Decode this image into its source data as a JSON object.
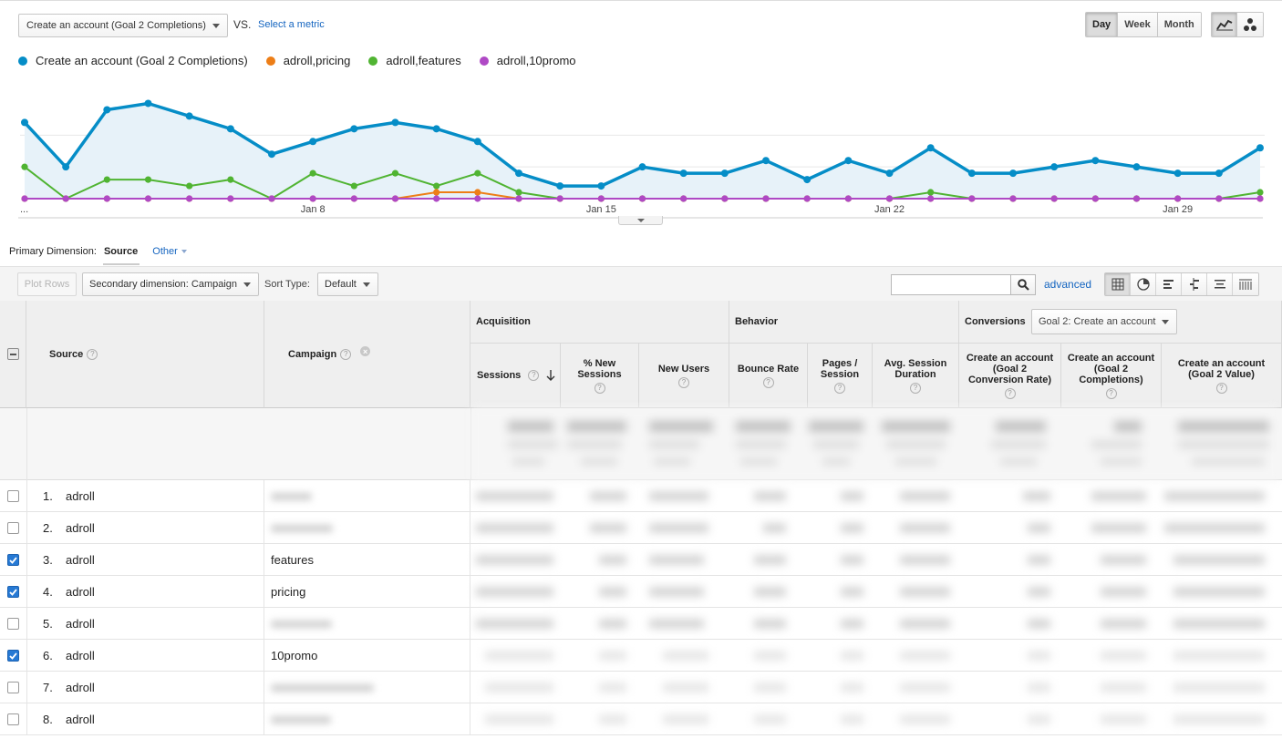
{
  "header": {
    "metric_select": "Create an account (Goal 2 Completions)",
    "vs_label": "VS.",
    "select_metric_link": "Select a metric",
    "periods": [
      "Day",
      "Week",
      "Month"
    ],
    "active_period": "Day"
  },
  "legend": [
    {
      "label": "Create an account (Goal 2 Completions)",
      "color": "#058dc7"
    },
    {
      "label": "adroll,pricing",
      "color": "#ed7e17"
    },
    {
      "label": "adroll,features",
      "color": "#50b432"
    },
    {
      "label": "adroll,10promo",
      "color": "#af49c5"
    }
  ],
  "chart_data": {
    "type": "line",
    "x_tick_labels": [
      "...",
      "Jan 8",
      "Jan 15",
      "Jan 22",
      "Jan 29"
    ],
    "series": [
      {
        "name": "Create an account (Goal 2 Completions)",
        "color": "#058dc7",
        "area": true,
        "values": [
          12,
          5,
          14,
          15,
          13,
          11,
          7,
          9,
          11,
          12,
          11,
          9,
          4,
          2,
          2,
          5,
          4,
          4,
          6,
          3,
          6,
          4,
          8,
          4,
          4,
          5,
          6,
          5,
          4,
          4,
          8
        ]
      },
      {
        "name": "adroll,pricing",
        "color": "#ed7e17",
        "area": false,
        "values": [
          0,
          0,
          0,
          0,
          0,
          0,
          0,
          0,
          0,
          0,
          1,
          1,
          0,
          0,
          0,
          0,
          0,
          0,
          0,
          0,
          0,
          0,
          0,
          0,
          0,
          0,
          0,
          0,
          0,
          0,
          0
        ]
      },
      {
        "name": "adroll,features",
        "color": "#50b432",
        "area": false,
        "values": [
          5,
          0,
          3,
          3,
          2,
          3,
          0,
          4,
          2,
          4,
          2,
          4,
          1,
          0,
          0,
          0,
          0,
          0,
          0,
          0,
          0,
          0,
          1,
          0,
          0,
          0,
          0,
          0,
          0,
          0,
          1
        ]
      },
      {
        "name": "adroll,10promo",
        "color": "#af49c5",
        "area": false,
        "values": [
          0,
          0,
          0,
          0,
          0,
          0,
          0,
          0,
          0,
          0,
          0,
          0,
          0,
          0,
          0,
          0,
          0,
          0,
          0,
          0,
          0,
          0,
          0,
          0,
          0,
          0,
          0,
          0,
          0,
          0,
          0
        ]
      }
    ],
    "grid": true
  },
  "primary_dimension": {
    "label": "Primary Dimension:",
    "source": "Source",
    "other": "Other"
  },
  "toolbar": {
    "plot_rows": "Plot Rows",
    "secondary_dimension": "Secondary dimension: Campaign",
    "sort_type_label": "Sort Type:",
    "sort_type_value": "Default",
    "advanced": "advanced"
  },
  "table": {
    "col_source": "Source",
    "col_campaign": "Campaign",
    "group_acquisition": "Acquisition",
    "group_behavior": "Behavior",
    "group_conversions": "Conversions",
    "goal_select": "Goal 2: Create an account",
    "cols": [
      {
        "label": "Sessions"
      },
      {
        "label": "% New Sessions"
      },
      {
        "label": "New Users"
      },
      {
        "label": "Bounce Rate"
      },
      {
        "label": "Pages / Session"
      },
      {
        "label": "Avg. Session Duration"
      },
      {
        "label": "Create an account (Goal 2 Conversion Rate)"
      },
      {
        "label": "Create an account (Goal 2 Completions)"
      },
      {
        "label": "Create an account (Goal 2 Value)"
      }
    ],
    "rows": [
      {
        "num": "1.",
        "source": "adroll",
        "campaign": "",
        "checked": false
      },
      {
        "num": "2.",
        "source": "adroll",
        "campaign": "",
        "checked": false
      },
      {
        "num": "3.",
        "source": "adroll",
        "campaign": "features",
        "checked": true
      },
      {
        "num": "4.",
        "source": "adroll",
        "campaign": "pricing",
        "checked": true
      },
      {
        "num": "5.",
        "source": "adroll",
        "campaign": "",
        "checked": false
      },
      {
        "num": "6.",
        "source": "adroll",
        "campaign": "10promo",
        "checked": true
      },
      {
        "num": "7.",
        "source": "adroll",
        "campaign": "",
        "checked": false
      },
      {
        "num": "8.",
        "source": "adroll",
        "campaign": "",
        "checked": false
      }
    ]
  }
}
